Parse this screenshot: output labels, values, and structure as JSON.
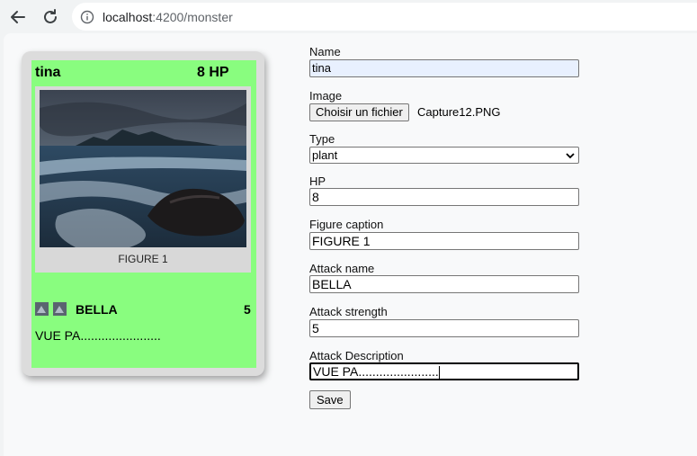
{
  "browser": {
    "url_host": "localhost",
    "url_path": ":4200/monster"
  },
  "card": {
    "name": "tina",
    "hp": "8 HP",
    "figure_caption": "FIGURE 1",
    "attack_name": "BELLA",
    "attack_strength": "5",
    "attack_description": "VUE PA......................."
  },
  "form": {
    "name_label": "Name",
    "name_value": "tina",
    "image_label": "Image",
    "file_button": "Choisir un fichier",
    "file_name": "Capture12.PNG",
    "type_label": "Type",
    "type_value": "plant",
    "hp_label": "HP",
    "hp_value": "8",
    "caption_label": "Figure caption",
    "caption_value": "FIGURE 1",
    "attack_name_label": "Attack name",
    "attack_name_value": "BELLA",
    "attack_strength_label": "Attack strength",
    "attack_strength_value": "5",
    "attack_desc_label": "Attack Description",
    "attack_desc_value": "VUE PA.......................",
    "save_label": "Save"
  },
  "colors": {
    "card_background": "#89fd7f",
    "autofill": "#e8f0fe"
  }
}
